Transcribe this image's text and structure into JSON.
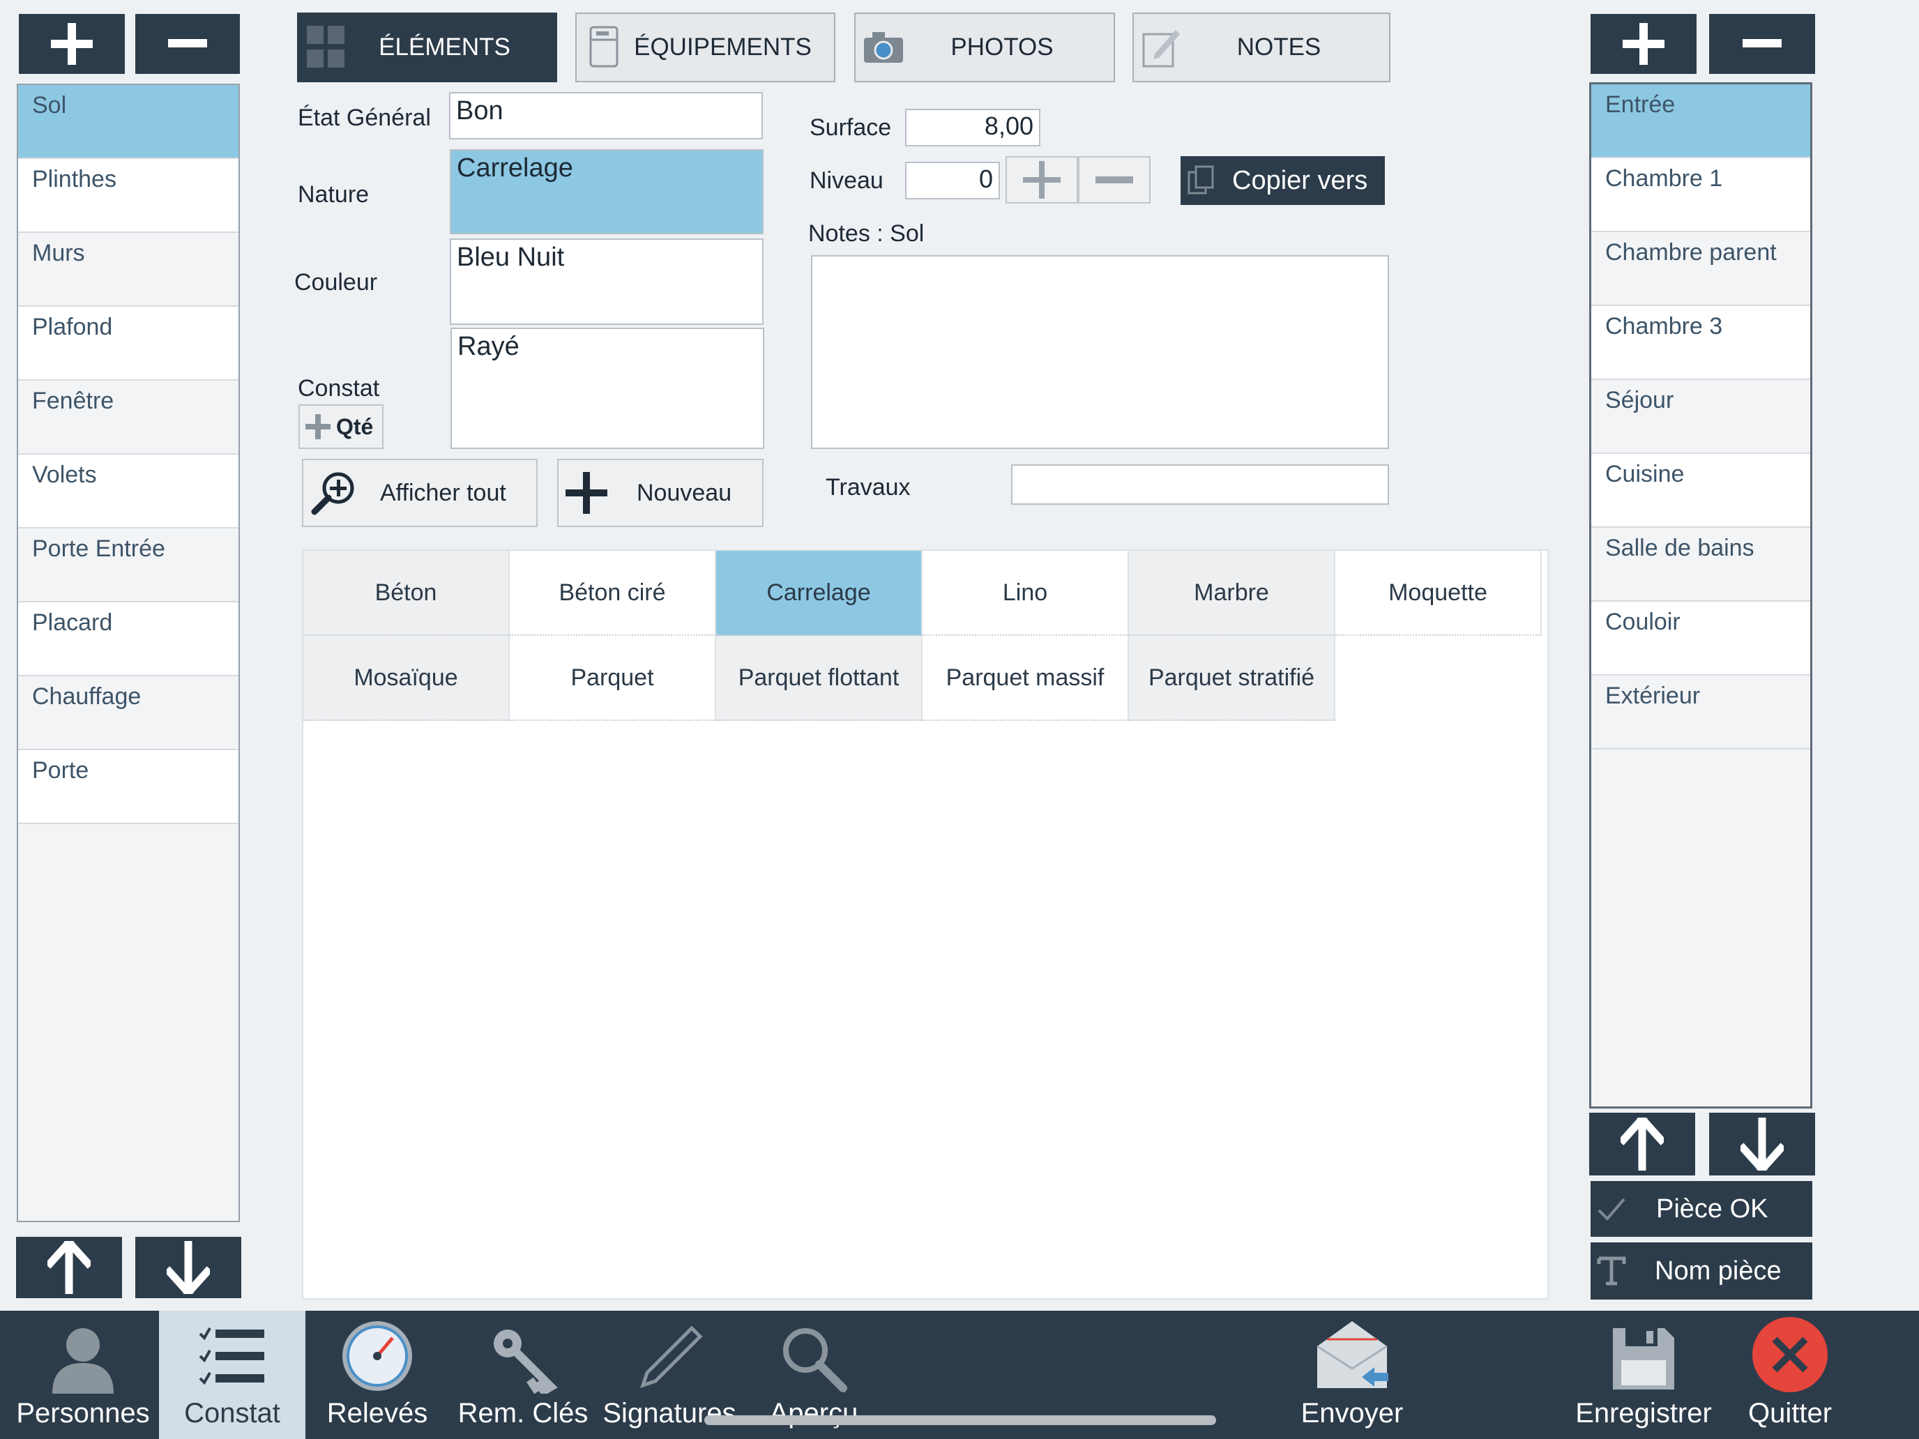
{
  "left_panel": {
    "add_icon": "plus-icon",
    "remove_icon": "minus-icon",
    "items": [
      "Sol",
      "Plinthes",
      "Murs",
      "Plafond",
      "Fenêtre",
      "Volets",
      "Porte Entrée",
      "Placard",
      "Chauffage",
      "Porte"
    ],
    "selected": "Sol",
    "up_icon": "arrow-up-icon",
    "down_icon": "arrow-down-icon"
  },
  "tabs": [
    {
      "label": "ÉLÉMENTS",
      "icon": "grid-icon",
      "active": true
    },
    {
      "label": "ÉQUIPEMENTS",
      "icon": "appliance-icon",
      "active": false
    },
    {
      "label": "PHOTOS",
      "icon": "camera-icon",
      "active": false
    },
    {
      "label": "NOTES",
      "icon": "note-icon",
      "active": false
    }
  ],
  "form": {
    "etat_label": "État Général",
    "etat_value": "Bon",
    "nature_label": "Nature",
    "nature_value": "Carrelage",
    "couleur_label": "Couleur",
    "couleur_value": "Bleu Nuit",
    "constat_label": "Constat",
    "constat_value": "Rayé",
    "qte_label": "Qté",
    "surface_label": "Surface",
    "surface_value": "8,00",
    "niveau_label": "Niveau",
    "niveau_value": "0",
    "copier_label": "Copier vers",
    "notes_label": "Notes : Sol",
    "notes_value": "",
    "travaux_label": "Travaux",
    "travaux_value": "",
    "afficher_label": "Afficher tout",
    "nouveau_label": "Nouveau"
  },
  "options": {
    "items": [
      "Béton",
      "Béton ciré",
      "Carrelage",
      "Lino",
      "Marbre",
      "Moquette",
      "Mosaïque",
      "Parquet",
      "Parquet flottant",
      "Parquet massif",
      "Parquet stratifié"
    ],
    "selected": "Carrelage"
  },
  "right_panel": {
    "items": [
      "Entrée",
      "Chambre 1",
      "Chambre parent",
      "Chambre 3",
      "Séjour",
      "Cuisine",
      "Salle de bains",
      "Couloir",
      "Extérieur"
    ],
    "selected": "Entrée",
    "piece_ok_label": "Pièce OK",
    "nom_piece_label": "Nom pièce"
  },
  "bottom_bar": [
    {
      "label": "Personnes",
      "icon": "person-icon",
      "active": false
    },
    {
      "label": "Constat",
      "icon": "checklist-icon",
      "active": true
    },
    {
      "label": "Relevés",
      "icon": "gauge-icon",
      "active": false
    },
    {
      "label": "Rem. Clés",
      "icon": "key-icon",
      "active": false
    },
    {
      "label": "Signatures",
      "icon": "pen-icon",
      "active": false
    },
    {
      "label": "Aperçu",
      "icon": "magnifier-icon",
      "active": false
    },
    {
      "label": "Envoyer",
      "icon": "envelope-icon",
      "active": false
    },
    {
      "label": "Enregistrer",
      "icon": "floppy-icon",
      "active": false
    },
    {
      "label": "Quitter",
      "icon": "close-icon",
      "active": false
    }
  ],
  "colors": {
    "dark": "#2d3c4a",
    "selected": "#8dc8e3",
    "quit_red": "#e5453b"
  }
}
